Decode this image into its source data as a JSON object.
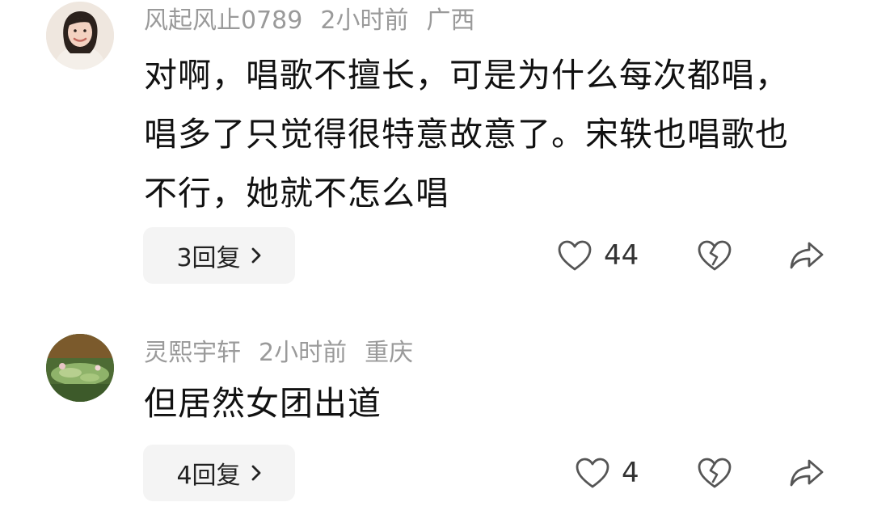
{
  "comments": [
    {
      "username": "风起风止0789",
      "time": "2小时前",
      "location": "广西",
      "text": "对啊，唱歌不擅长，可是为什么每次都唱，唱多了只觉得很特意故意了。宋轶也唱歌也不行，她就不怎么唱",
      "replies_label": "3回复",
      "likes": "44",
      "avatar_icon": "woman-portrait-icon"
    },
    {
      "username": "灵熙宇轩",
      "time": "2小时前",
      "location": "重庆",
      "text": "但居然女团出道",
      "replies_label": "4回复",
      "likes": "4",
      "avatar_icon": "lotus-pond-icon"
    }
  ],
  "icons": {
    "like": "heart-icon",
    "dislike": "broken-heart-icon",
    "share": "share-arrow-icon",
    "chevron": "chevron-right-icon"
  }
}
